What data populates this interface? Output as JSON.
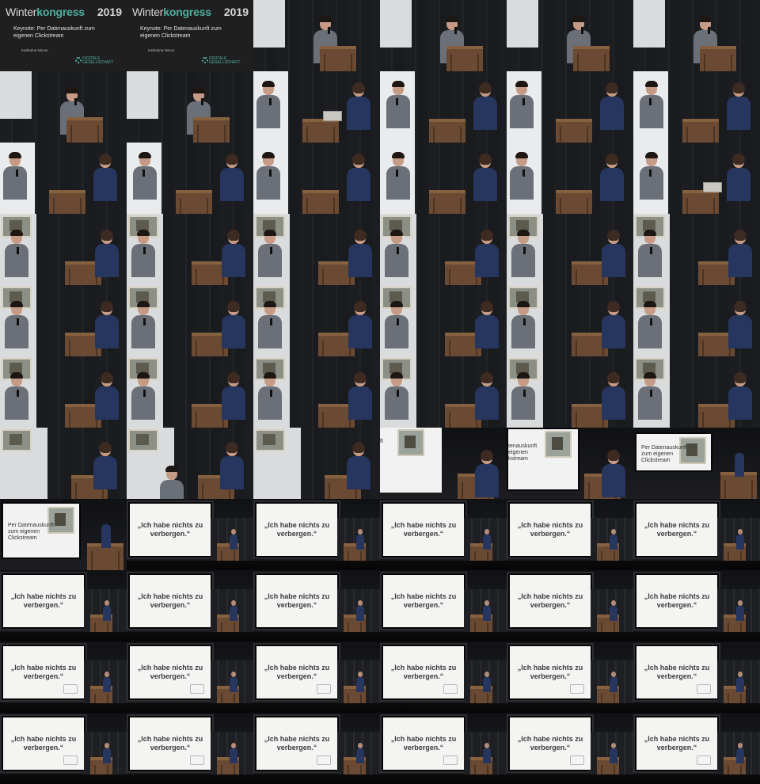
{
  "title_card": {
    "brand_prefix": "Winter",
    "brand_suffix": "kongress",
    "year": "2019",
    "subtitle": "Keynote: Per Datenauskunft zum eigenen Clickstream",
    "speaker": "Katharina Nocun",
    "org_line1": "DIGITALE",
    "org_line2": "GESELLSCHAFT"
  },
  "slide": {
    "intro_line1": "Per Datenauskunft",
    "intro_line2": "zum eigenen",
    "intro_line3": "Clickstream",
    "partial1": "tenauskunft",
    "partial2": "eigenen",
    "partial3": "kstream",
    "fragment": "ft",
    "quote_line1": "„Ich habe nichts zu",
    "quote_line2": "verbergen.“"
  },
  "colors": {
    "accent": "#4fb0a0",
    "jacket": "#6b6f77",
    "dress": "#26365e",
    "lectern": "#6a4a32",
    "screen": "#f4f4f3"
  },
  "grid": {
    "columns": 6,
    "rows": 11,
    "tiles": [
      "title",
      "title",
      "stage-man",
      "stage-man",
      "stage-man",
      "stage-man",
      "stage-man",
      "stage-man",
      "duo-laptop",
      "duo",
      "duo",
      "duo",
      "duo",
      "duo",
      "duo",
      "duo",
      "duo",
      "duo-laptop",
      "duo-stamp",
      "duo-stamp",
      "duo-stamp",
      "duo-stamp",
      "duo-stamp",
      "duo-stamp",
      "duo-stamp",
      "duo-stamp",
      "duo-stamp",
      "duo-stamp",
      "duo-stamp",
      "duo-stamp",
      "duo-stamp",
      "duo-stamp",
      "duo-stamp",
      "duo-stamp",
      "duo-stamp",
      "duo-stamp",
      "woman-stamp",
      "woman-exit",
      "woman-stamp",
      "slide-partial",
      "slide-partial2",
      "slide-intro",
      "slide-intro-big",
      "proj",
      "proj",
      "proj",
      "proj",
      "proj",
      "proj",
      "proj",
      "proj",
      "proj",
      "proj",
      "proj",
      "proj-pict",
      "proj-pict",
      "proj-pict",
      "proj-pict",
      "proj-pict",
      "proj-pict",
      "proj-pict",
      "proj-pict",
      "proj-pict",
      "proj-pict",
      "proj-pict",
      "proj-pict"
    ]
  }
}
